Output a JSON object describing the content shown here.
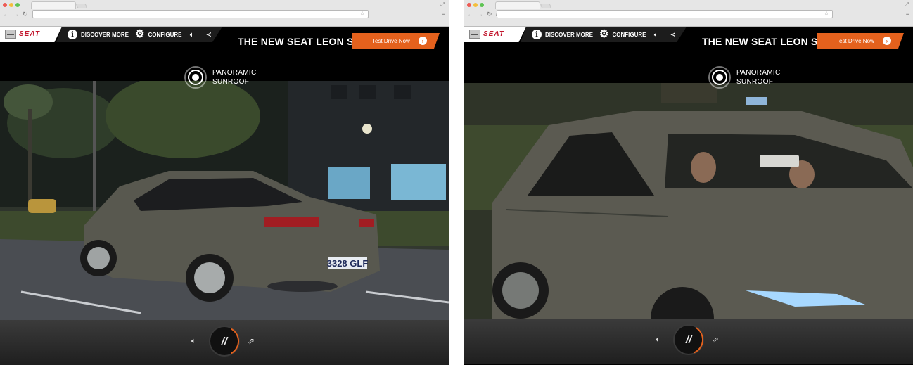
{
  "screens": [
    {
      "brand": "SEAT",
      "nav": {
        "discover": "DISCOVER MORE",
        "configure": "CONFIGURE"
      },
      "headline": "THE NEW SEAT LEON ST",
      "cta": "Test Drive Now",
      "feature": {
        "line1": "PANORAMIC",
        "line2": "SUNROOF"
      },
      "plate": "3328 GLF"
    },
    {
      "brand": "SEAT",
      "nav": {
        "discover": "DISCOVER MORE",
        "configure": "CONFIGURE"
      },
      "headline": "THE NEW SEAT LEON ST",
      "cta": "Test Drive Now",
      "feature": {
        "line1": "PANORAMIC",
        "line2": "SUNROOF"
      }
    }
  ],
  "icons": {
    "info": "info-icon",
    "configure": "gear-icon",
    "sound": "speaker-icon",
    "share": "share-icon",
    "cta_arrow": "chevron-right-icon",
    "pause": "pause-icon",
    "feature": "sunroof-icon"
  },
  "colors": {
    "brand_red": "#c2162d",
    "cta_orange": "#e4611d",
    "progress_orange": "#e4611d"
  }
}
